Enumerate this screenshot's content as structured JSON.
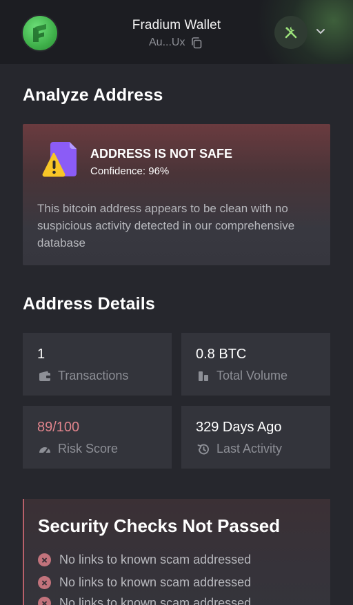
{
  "header": {
    "wallet_name": "Fradium Wallet",
    "wallet_address": "Au...Ux",
    "logo_icon": "fradium-logo-icon",
    "tools_icon": "tools-icon",
    "menu_icon": "chevron-down-icon"
  },
  "analyze": {
    "title": "Analyze Address",
    "status_title": "ADDRESS IS NOT SAFE",
    "confidence": "Confidence: 96%",
    "description": "This bitcoin address appears to be clean with no suspicious activity detected in our comprehensive database"
  },
  "details": {
    "title": "Address Details",
    "stats": [
      {
        "value": "1",
        "label": "Transactions",
        "icon": "wallet-icon",
        "value_color": "#ffffff"
      },
      {
        "value": "0.8 BTC",
        "label": "Total Volume",
        "icon": "bar-chart-icon",
        "value_color": "#ffffff"
      },
      {
        "value": "89/100",
        "label": "Risk Score",
        "icon": "gauge-icon",
        "value_color": "#e0848c"
      },
      {
        "value": "329 Days Ago",
        "label": "Last Activity",
        "icon": "history-icon",
        "value_color": "#ffffff"
      }
    ]
  },
  "security": {
    "title": "Security Checks Not Passed",
    "items": [
      "No links to known scam addressed",
      "No links to known scam addressed",
      "No links to known scam addressed"
    ]
  },
  "colors": {
    "accent_green": "#4cc85a",
    "danger": "#c2737c",
    "background": "#26272d"
  }
}
